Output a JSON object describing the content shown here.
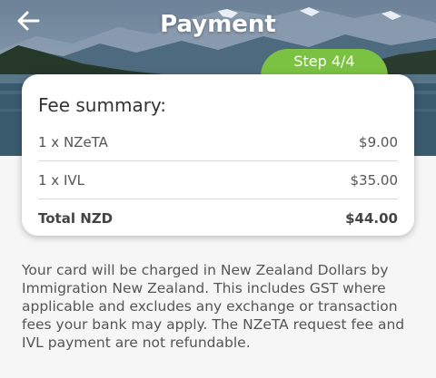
{
  "header": {
    "title": "Payment",
    "back_icon": "arrow-left-icon",
    "step_label": "Step 4/4",
    "accent_color": "#7cc242"
  },
  "fee_summary": {
    "title": "Fee summary:",
    "items": [
      {
        "label": "1 x NZeTA",
        "amount": "$9.00"
      },
      {
        "label": "1 x IVL",
        "amount": "$35.00"
      }
    ],
    "total": {
      "label": "Total NZD",
      "amount": "$44.00"
    }
  },
  "notice": "Your card will be charged in New Zealand Dollars by Immigration New Zealand. This includes GST where applicable and excludes any exchange or transaction fees your bank may apply. The NZeTA request fee and IVL payment are not refundable."
}
